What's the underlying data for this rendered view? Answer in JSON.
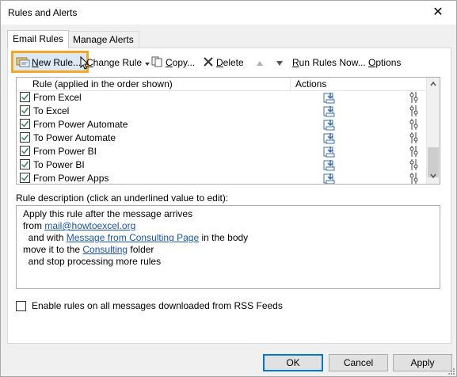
{
  "window": {
    "title": "Rules and Alerts",
    "close_glyph": "✕"
  },
  "tabs": [
    {
      "label": "Email Rules",
      "active": true
    },
    {
      "label": "Manage Alerts",
      "active": false
    }
  ],
  "toolbar": {
    "new_rule": {
      "prefix": "",
      "accel": "N",
      "rest": "ew Rule...",
      "icon": "new-rule-icon"
    },
    "change_rule": {
      "accel": "C",
      "rest": "hange Rule",
      "icon": "dropdown-arrow-icon"
    },
    "copy": {
      "prefix": "",
      "accel": "C",
      "rest": "opy...",
      "icon": "copy-icon"
    },
    "delete": {
      "accel": "D",
      "rest": "elete",
      "icon": "delete-x-icon"
    },
    "move_up_icon": "up-arrow-icon",
    "move_down_icon": "down-arrow-icon",
    "run_rules": {
      "accel": "R",
      "rest": "un Rules Now..."
    },
    "options": {
      "accel": "O",
      "rest": "ptions"
    }
  },
  "rules_list": {
    "col_rule": "Rule (applied in the order shown)",
    "col_actions": "Actions",
    "rows": [
      {
        "name": "From Excel",
        "checked": true
      },
      {
        "name": "To Excel",
        "checked": true
      },
      {
        "name": "From Power Automate",
        "checked": true
      },
      {
        "name": "To Power Automate",
        "checked": true
      },
      {
        "name": "From Power BI",
        "checked": true
      },
      {
        "name": "To Power BI",
        "checked": true
      },
      {
        "name": "From Power Apps",
        "checked": true
      }
    ]
  },
  "description": {
    "label": "Rule description (click an underlined value to edit):",
    "line1": "Apply this rule after the message arrives",
    "line2_prefix": "from ",
    "line2_link": "mail@howtoexcel.org",
    "line3_prefix": "  and with ",
    "line3_link": "Message from Consulting Page",
    "line3_suffix": " in the body",
    "line4_prefix": "move it to the ",
    "line4_link": "Consulting",
    "line4_suffix": " folder",
    "line5": "  and stop processing more rules"
  },
  "rss_option": {
    "label": "Enable rules on all messages downloaded from RSS Feeds",
    "checked": false
  },
  "buttons": {
    "ok": "OK",
    "cancel": "Cancel",
    "apply": "Apply"
  },
  "colors": {
    "accent": "#0078d7",
    "highlight": "#f5a623",
    "link": "#1a56a8",
    "check": "#2e8b57"
  }
}
